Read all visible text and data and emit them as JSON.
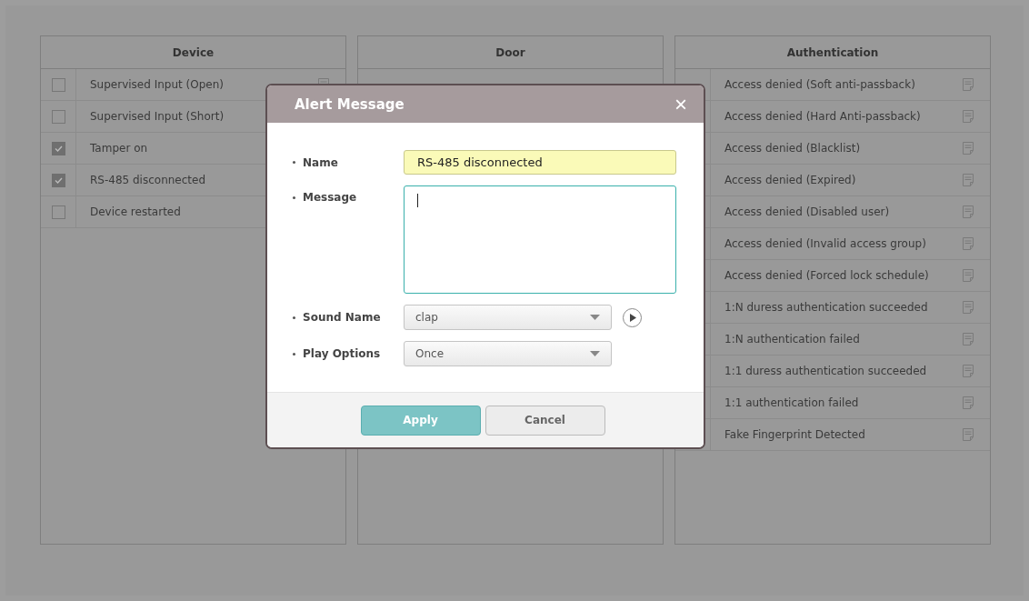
{
  "panels": [
    {
      "title": "Device",
      "items": [
        {
          "label": "Supervised Input (Open)",
          "checked": false
        },
        {
          "label": "Supervised Input (Short)",
          "checked": false
        },
        {
          "label": "Tamper on",
          "checked": true
        },
        {
          "label": "RS-485 disconnected",
          "checked": true
        },
        {
          "label": "Device restarted",
          "checked": false
        }
      ]
    },
    {
      "title": "Door"
    },
    {
      "title": "Authentication",
      "items": [
        {
          "label": "Access denied (Soft anti-passback)"
        },
        {
          "label": "Access denied (Hard Anti-passback)"
        },
        {
          "label": "Access denied (Blacklist)"
        },
        {
          "label": "Access denied (Expired)"
        },
        {
          "label": "Access denied (Disabled user)"
        },
        {
          "label": "Access denied (Invalid access group)"
        },
        {
          "label": "Access denied (Forced lock schedule)"
        },
        {
          "label": "1:N duress authentication succeeded"
        },
        {
          "label": "1:N authentication failed"
        },
        {
          "label": "1:1 duress authentication succeeded"
        },
        {
          "label": "1:1 authentication failed"
        },
        {
          "label": "Fake Fingerprint Detected"
        }
      ]
    }
  ],
  "dialog": {
    "title": "Alert Message",
    "close": "×",
    "fields": [
      {
        "kind": "text",
        "label": "Name",
        "value": "RS-485 disconnected"
      },
      {
        "kind": "textarea",
        "label": "Message"
      },
      {
        "kind": "select",
        "label": "Sound Name",
        "value": "clap",
        "play": true
      },
      {
        "kind": "select",
        "label": "Play Options",
        "value": "Once"
      }
    ],
    "buttons": [
      {
        "label": "Apply",
        "primary": true
      },
      {
        "label": "Cancel",
        "primary": false
      }
    ]
  }
}
